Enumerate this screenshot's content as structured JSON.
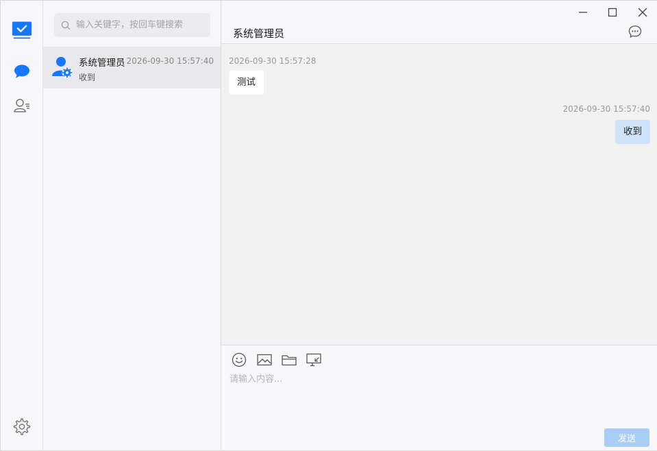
{
  "nav": {
    "items": [
      {
        "name": "workspace",
        "icon": "checkmark-board-icon",
        "active": true
      },
      {
        "name": "messages",
        "icon": "chat-bubble-icon"
      },
      {
        "name": "contacts",
        "icon": "contacts-icon"
      },
      {
        "name": "settings",
        "icon": "gear-icon"
      }
    ],
    "accent": "#1677ff"
  },
  "search": {
    "placeholder": "输入关键字，按回车键搜索",
    "value": ""
  },
  "conversations": [
    {
      "name": "系统管理员",
      "time": "2026-09-30 15:57:40",
      "preview": "收到",
      "selected": true
    }
  ],
  "chat": {
    "title": "系统管理员",
    "messages": [
      {
        "direction": "in",
        "time": "2026-09-30 15:57:28",
        "text": "测试"
      },
      {
        "direction": "out",
        "time": "2026-09-30 15:57:40",
        "text": "收到"
      }
    ]
  },
  "composer": {
    "tools": [
      "emoji-icon",
      "image-icon",
      "folder-icon",
      "screenshot-icon"
    ],
    "placeholder": "请输入内容...",
    "value": "",
    "send_label": "发送"
  },
  "window": {
    "controls": [
      "minimize",
      "maximize",
      "close"
    ]
  }
}
